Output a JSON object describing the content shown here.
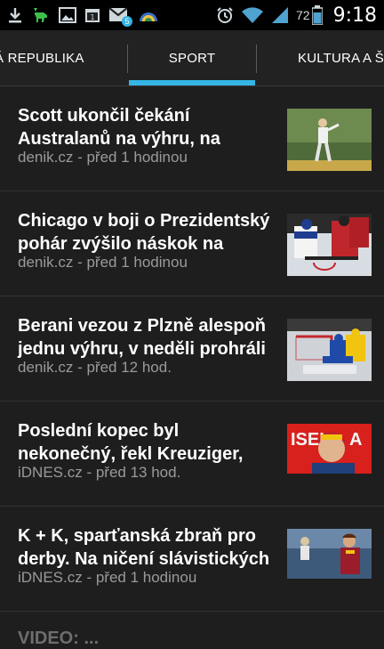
{
  "status_bar": {
    "time": "9:18",
    "battery_percent": "72",
    "mail_badge": "5",
    "icons": [
      "download-icon",
      "deer-icon",
      "gallery-icon",
      "calendar-icon",
      "gmail-icon",
      "weather-icon",
      "alarm-icon",
      "wifi-icon",
      "signal-icon",
      "battery-icon"
    ]
  },
  "tabs": [
    {
      "label": "Á REPUBLIKA",
      "selected": false
    },
    {
      "label": "SPORT",
      "selected": true
    },
    {
      "label": "KULTURA A Š",
      "selected": false
    }
  ],
  "colors": {
    "accent": "#33b5e5",
    "background": "#1e1e1e",
    "meta": "#9a9a9a"
  },
  "articles": [
    {
      "title": "Scott ukončil čekání Australanů na výhru, na",
      "source": "denik.cz",
      "time": "před 1 hodinou",
      "meta": "denik.cz - před 1 hodinou",
      "thumb": "golf-photo"
    },
    {
      "title": "Chicago v boji o Prezidentský pohár zvýšilo náskok na",
      "source": "denik.cz",
      "time": "před 1 hodinou",
      "meta": "denik.cz - před 1 hodinou",
      "thumb": "hockey-photo"
    },
    {
      "title": "Berani vezou z Plzně alespoň jednu výhru, v neděli prohráli",
      "source": "denik.cz",
      "time": "před 12 hod.",
      "meta": "denik.cz - před 12 hod.",
      "thumb": "hockey-goal-photo"
    },
    {
      "title": "Poslední kopec byl nekonečný, řekl Kreuziger,",
      "source": "iDNES.cz",
      "time": "před 13 hod.",
      "meta": "iDNES.cz - před 13 hod.",
      "thumb": "cyclist-photo"
    },
    {
      "title": "K + K, sparťanská zbraň pro derby. Na ničení slávistických",
      "source": "iDNES.cz",
      "time": "před 1 hodinou",
      "meta": "iDNES.cz - před 1 hodinou",
      "thumb": "football-photo"
    }
  ],
  "partial_article": {
    "title": "VIDEO: ..."
  }
}
